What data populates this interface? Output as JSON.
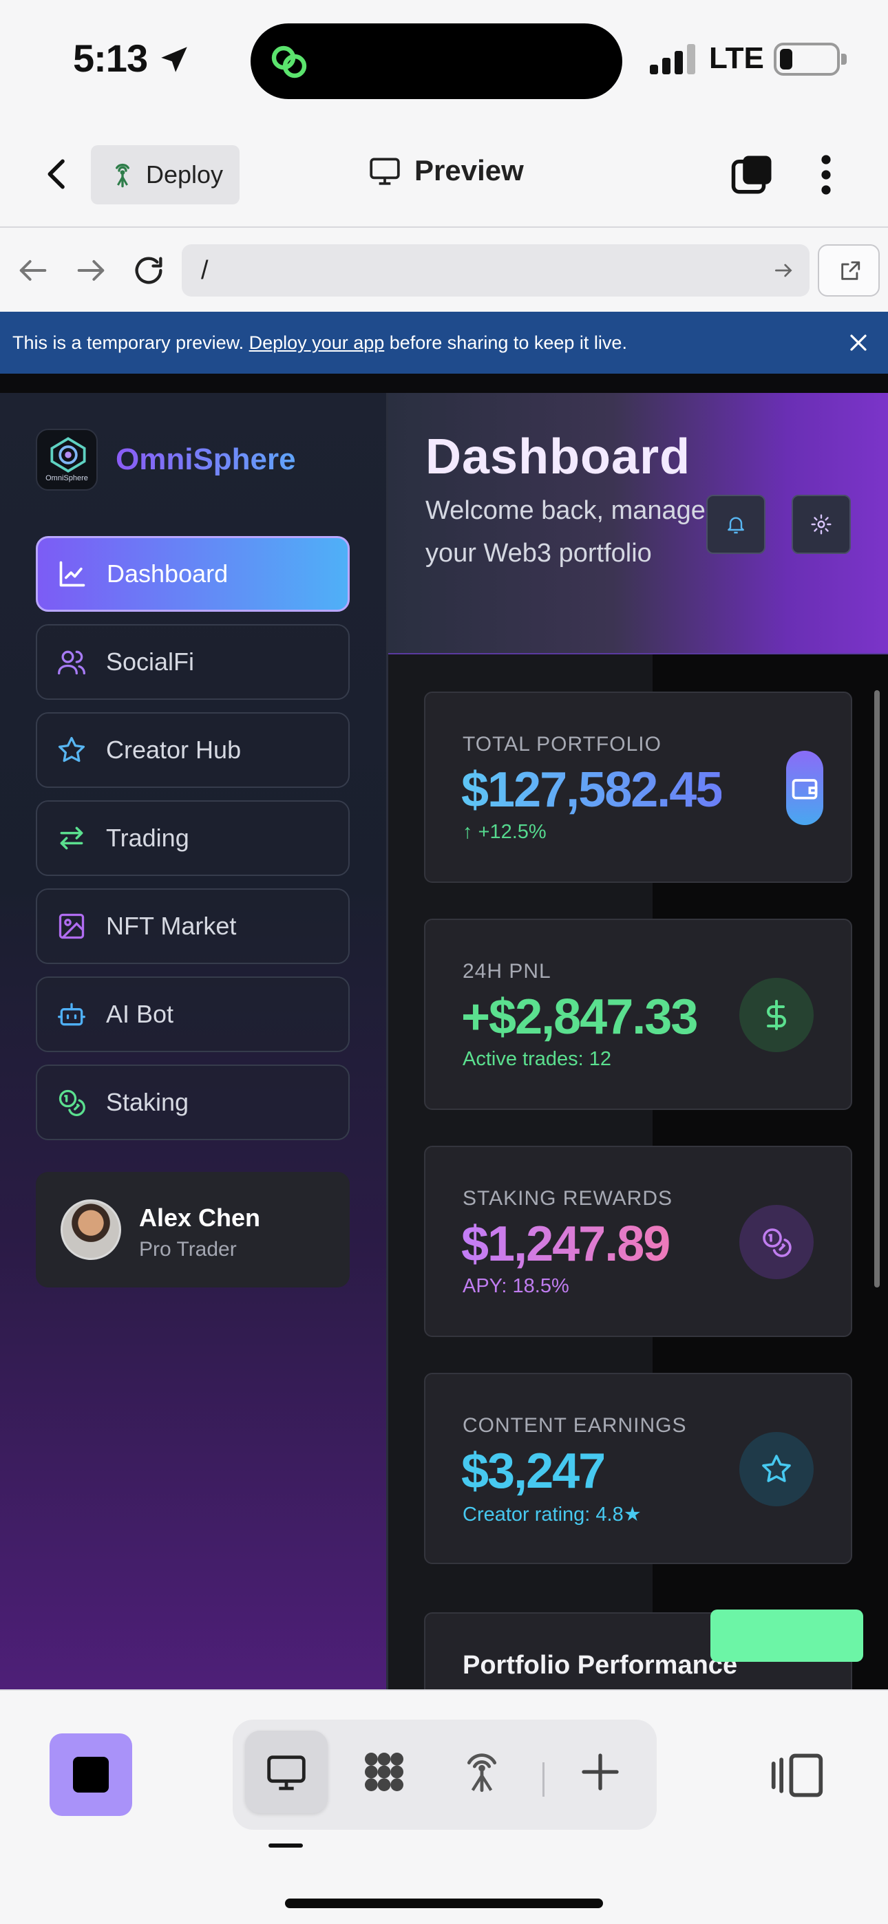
{
  "status_bar": {
    "time": "5:13",
    "network": "LTE"
  },
  "header": {
    "deploy_label": "Deploy",
    "title": "Preview"
  },
  "browser": {
    "url": "/"
  },
  "banner": {
    "text_before": "This is a temporary preview. ",
    "link_text": "Deploy your app",
    "text_after": " before sharing to keep it live."
  },
  "app": {
    "brand": {
      "name": "OmniSphere",
      "logo_text": "OmniSphere"
    },
    "nav": [
      {
        "label": "Dashboard",
        "icon": "chart-line-icon",
        "active": true
      },
      {
        "label": "SocialFi",
        "icon": "users-icon"
      },
      {
        "label": "Creator Hub",
        "icon": "star-icon"
      },
      {
        "label": "Trading",
        "icon": "arrows-exchange-icon"
      },
      {
        "label": "NFT Market",
        "icon": "image-icon"
      },
      {
        "label": "AI Bot",
        "icon": "bot-icon"
      },
      {
        "label": "Staking",
        "icon": "coins-icon"
      }
    ],
    "user": {
      "name": "Alex Chen",
      "role": "Pro Trader"
    },
    "hero": {
      "title": "Dashboard",
      "subtitle": "Welcome back, manage your Web3 portfolio"
    },
    "stats": [
      {
        "label": "TOTAL PORTFOLIO",
        "value": "$127,582.45",
        "sub": "↑ +12.5%",
        "icon": "wallet-icon"
      },
      {
        "label": "24H PNL",
        "value": "+$2,847.33",
        "sub": "Active trades: 12",
        "icon": "dollar-icon"
      },
      {
        "label": "STAKING REWARDS",
        "value": "$1,247.89",
        "sub": "APY: 18.5%",
        "icon": "coins-icon"
      },
      {
        "label": "CONTENT EARNINGS",
        "value": "$3,247",
        "sub": "Creator rating: 4.8★",
        "icon": "star-icon"
      }
    ],
    "performance_title": "Portfolio Performance"
  },
  "colors": {
    "accent": "#7c5cf5",
    "banner": "#1f4b8c",
    "positive": "#5be08f"
  }
}
